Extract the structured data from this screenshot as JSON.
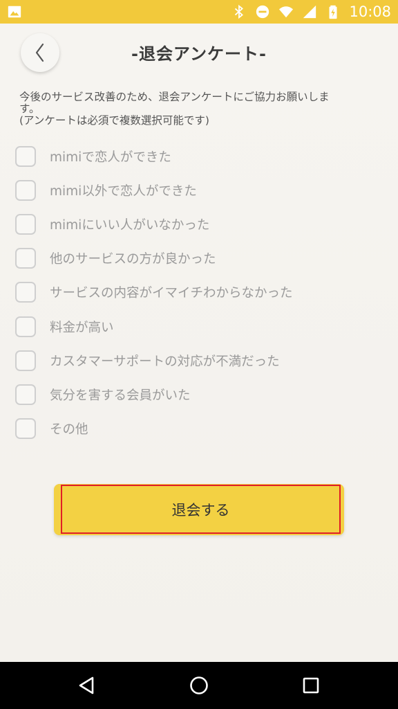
{
  "status_bar": {
    "time": "10:08",
    "icons": [
      "image-icon",
      "bluetooth-icon",
      "do-not-disturb-icon",
      "wifi-icon",
      "signal-icon",
      "battery-charging-icon"
    ]
  },
  "header": {
    "title": "-退会アンケート-",
    "back_icon": "chevron-left-icon"
  },
  "intro": {
    "line1": "今後のサービス改善のため、退会アンケートにご協力お願いしま",
    "line2": "す。",
    "line3": "(アンケートは必須で複数選択可能です)"
  },
  "options": [
    {
      "label": "mimiで恋人ができた",
      "checked": false
    },
    {
      "label": "mimi以外で恋人ができた",
      "checked": false
    },
    {
      "label": "mimiにいい人がいなかった",
      "checked": false
    },
    {
      "label": "他のサービスの方が良かった",
      "checked": false
    },
    {
      "label": "サービスの内容がイマイチわからなかった",
      "checked": false
    },
    {
      "label": "料金が高い",
      "checked": false
    },
    {
      "label": "カスタマーサポートの対応が不満だった",
      "checked": false
    },
    {
      "label": "気分を害する会員がいた",
      "checked": false
    },
    {
      "label": "その他",
      "checked": false
    }
  ],
  "submit": {
    "label": "退会する"
  },
  "nav_bar": {
    "icons": [
      "back-triangle-icon",
      "home-circle-icon",
      "recents-square-icon"
    ]
  },
  "colors": {
    "status_bar": "#f2c93b",
    "button": "#f3d143",
    "highlight_border": "#e01e26",
    "background": "#f4f2ee"
  }
}
